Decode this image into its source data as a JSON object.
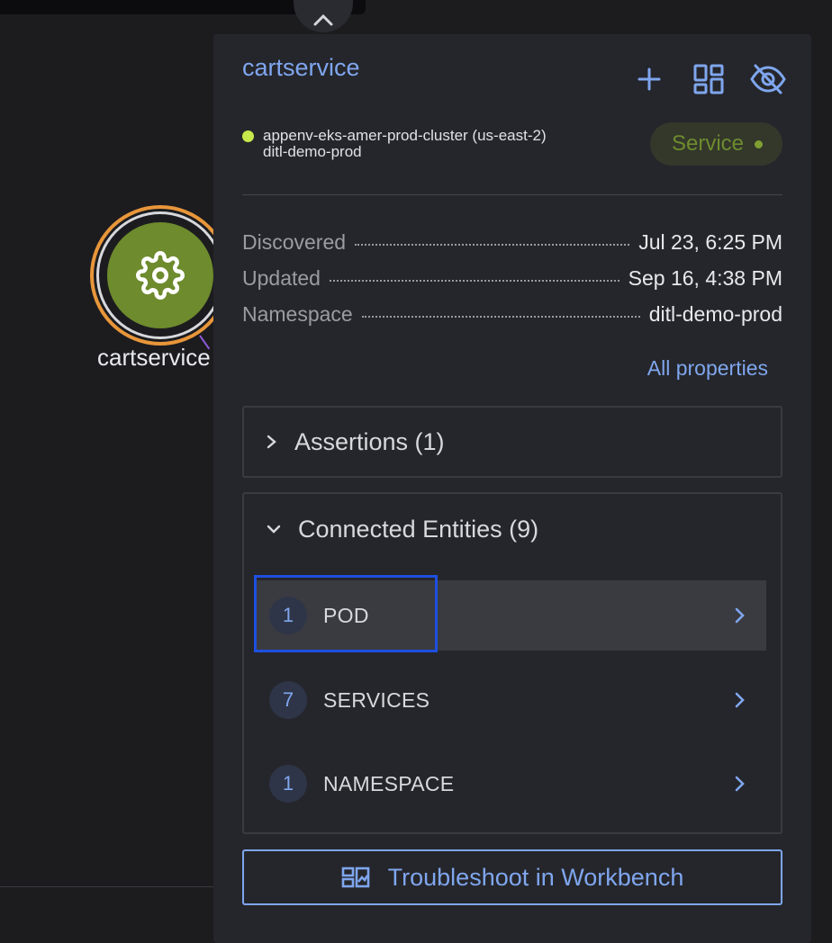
{
  "canvas": {
    "node": {
      "label": "cartservice",
      "icon": "gear-icon",
      "ring_color": "#e8963a",
      "fill_color": "#6e8b2d"
    },
    "collapse_icon": "chevron-up-icon"
  },
  "panel": {
    "title": "cartservice",
    "header_icons": [
      "plus-icon",
      "dashboard-icon",
      "eye-off-icon"
    ],
    "cluster": {
      "name": "appenv-eks-amer-prod-cluster (us-east-2)",
      "namespace": "ditl-demo-prod",
      "status_color": "#c7e84a"
    },
    "badge": {
      "label": "Service",
      "color": "#6e8b2d"
    },
    "properties": [
      {
        "key": "Discovered",
        "value": "Jul 23, 6:25 PM"
      },
      {
        "key": "Updated",
        "value": "Sep 16, 4:38 PM"
      },
      {
        "key": "Namespace",
        "value": "ditl-demo-prod"
      }
    ],
    "all_properties_label": "All properties",
    "assertions": {
      "label": "Assertions (1)",
      "expanded": false
    },
    "connected": {
      "label": "Connected Entities (9)",
      "expanded": true,
      "items": [
        {
          "count": "1",
          "label": "POD",
          "selected": true
        },
        {
          "count": "7",
          "label": "SERVICES",
          "selected": false
        },
        {
          "count": "1",
          "label": "NAMESPACE",
          "selected": false
        }
      ]
    },
    "troubleshoot_label": "Troubleshoot in Workbench",
    "accent_color": "#7fa6ee"
  }
}
